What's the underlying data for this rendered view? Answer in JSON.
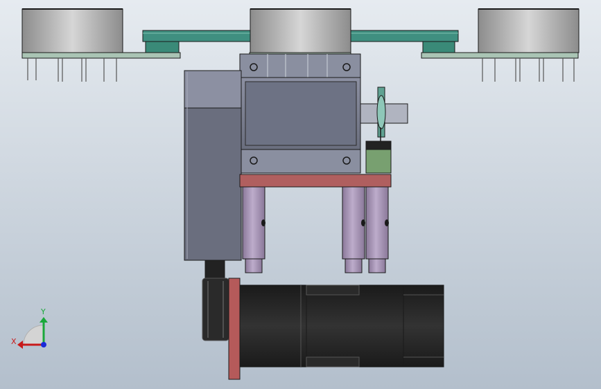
{
  "viewport": {
    "background_top": "#e6ebf0",
    "background_bottom": "#b3bfcc"
  },
  "triad": {
    "x_label": "X",
    "y_label": "Y",
    "x_color": "#c81a1a",
    "y_color": "#1aa83a",
    "z_color": "#1a2ad8"
  },
  "palette": {
    "cylinder_light": "#d0d0d0",
    "cylinder_dark": "#8c8c8c",
    "rail_green": "#3f8f80",
    "rail_pale": "#a9c4b4",
    "housing_fill": "#6b6f80",
    "housing_light": "#9a9fb2",
    "plate_red": "#b05f5f",
    "pneumatic_purple": "#a995b8",
    "motor_black": "#262626",
    "flange_red": "#b55a5a",
    "sensor_green": "#78a070",
    "outline": "#1a1a1a"
  }
}
